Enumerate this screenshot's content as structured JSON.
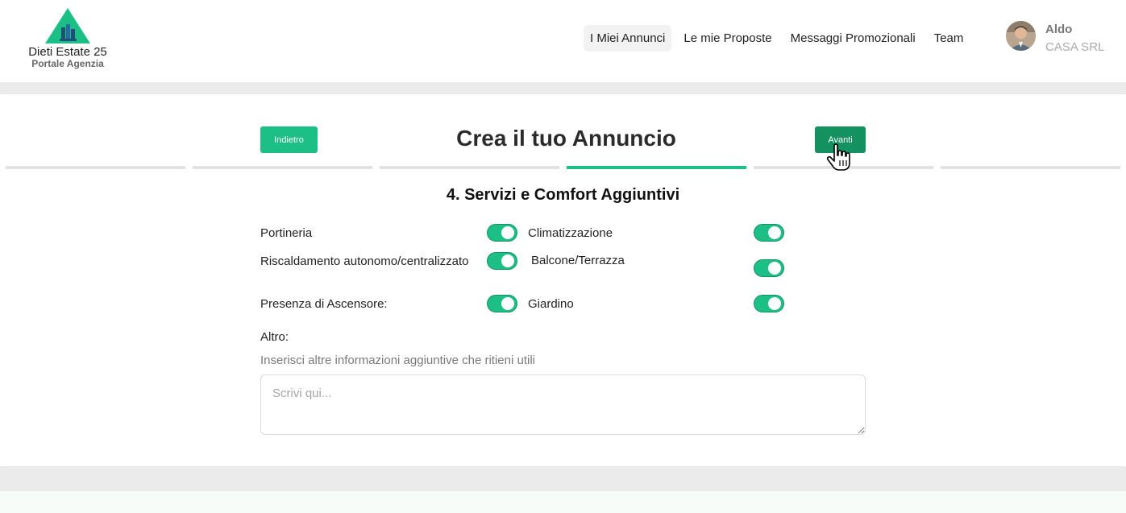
{
  "brand": {
    "name": "Dieti Estate 25",
    "subtitle": "Portale Agenzia"
  },
  "nav": {
    "items": [
      {
        "label": "I Miei Annunci",
        "active": true
      },
      {
        "label": "Le mie Proposte",
        "active": false
      },
      {
        "label": "Messaggi Promozionali",
        "active": false
      },
      {
        "label": "Team",
        "active": false
      }
    ]
  },
  "user": {
    "name": "Aldo",
    "company": "CASA SRL"
  },
  "wizard": {
    "back_label": "Indietro",
    "next_label": "Avanti",
    "title": "Crea il tuo Annuncio",
    "steps_total": 6,
    "active_step": 4
  },
  "section": {
    "title": "4. Servizi e Comfort Aggiuntivi"
  },
  "services": [
    {
      "label": "Portineria",
      "enabled": true
    },
    {
      "label": "Climatizzazione",
      "enabled": true
    },
    {
      "label": "Riscaldamento autonomo/centralizzato",
      "enabled": true
    },
    {
      "label": "Balcone/Terrazza",
      "enabled": true
    },
    {
      "label": "Presenza di Ascensore:",
      "enabled": true
    },
    {
      "label": "Giardino",
      "enabled": true
    }
  ],
  "other": {
    "label": "Altro:",
    "hint": "Inserisci altre informazioni aggiuntive che ritieni utili",
    "placeholder": "Scrivi qui...",
    "value": ""
  },
  "colors": {
    "accent": "#1cbf85",
    "accent_dark": "#13915f",
    "band": "#ebebeb"
  }
}
